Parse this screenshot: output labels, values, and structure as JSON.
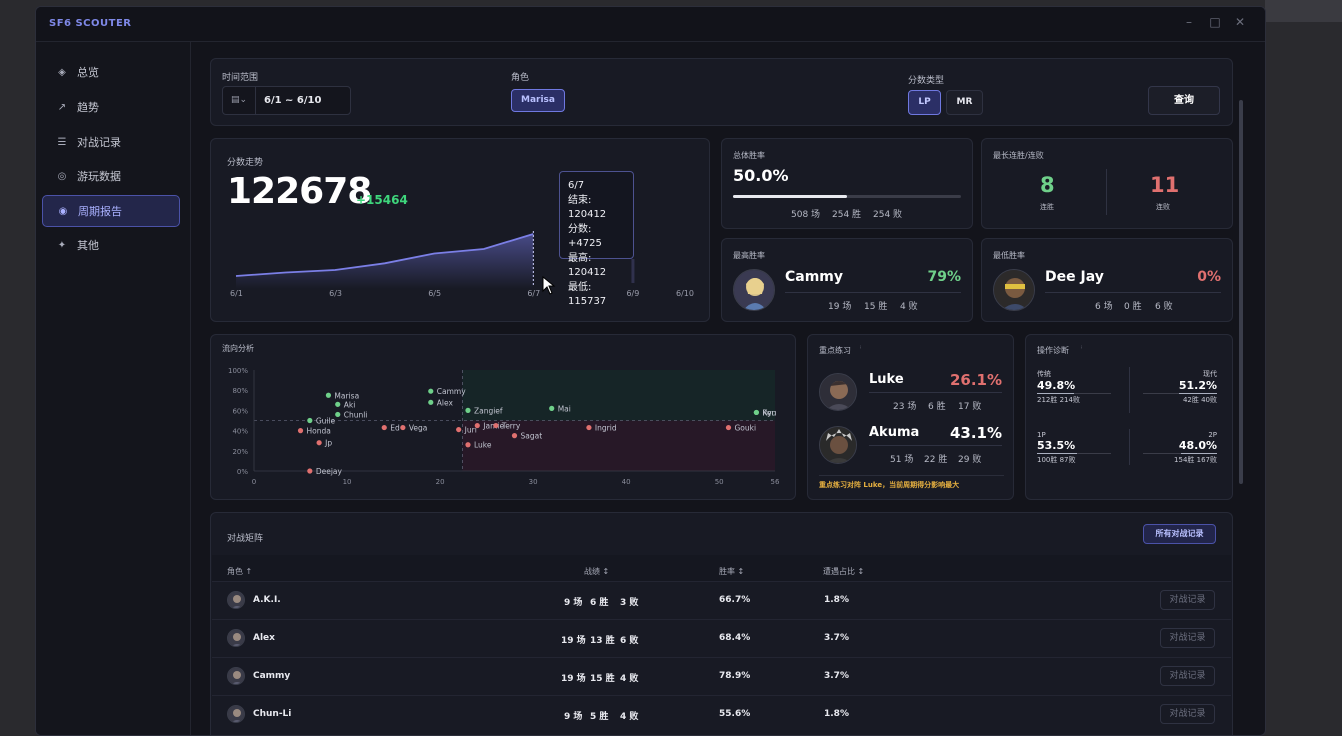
{
  "app": {
    "title": "SF6 SCOUTER"
  },
  "window_controls": {
    "minimize": "–",
    "maximize": "□",
    "close": "✕"
  },
  "sidebar": {
    "items": [
      {
        "label": "总览",
        "icon": "◈"
      },
      {
        "label": "趋势",
        "icon": "↗"
      },
      {
        "label": "对战记录",
        "icon": "☰"
      },
      {
        "label": "游玩数据",
        "icon": "◎"
      },
      {
        "label": "周期报告",
        "icon": "◉"
      },
      {
        "label": "其他",
        "icon": "✦"
      }
    ]
  },
  "filters": {
    "time_label": "时间范围",
    "time_value": "6/1 ~ 6/10",
    "char_label": "角色",
    "char_value": "Marisa",
    "score_label": "分数类型",
    "lp": "LP",
    "mr": "MR",
    "query": "查询"
  },
  "trend": {
    "title": "分数走势",
    "value": "122678",
    "delta": "+15464",
    "xticks": [
      "6/1",
      "6/3",
      "6/5",
      "6/7",
      "6/9",
      "6/10"
    ],
    "tooltip": [
      "6/7",
      "结束: 120412",
      "分数: +4725",
      "最高: 120412",
      "最低: 115737"
    ]
  },
  "overall": {
    "title": "总体胜率",
    "rate": "50.0%",
    "rate_value": 0.5,
    "games": "508 场",
    "wins": "254 胜",
    "losses": "254 败"
  },
  "streak": {
    "title": "最长连胜/连败",
    "win_value": "8",
    "win_label": "连胜",
    "lose_value": "11",
    "lose_label": "连败"
  },
  "best": {
    "title": "最高胜率",
    "name": "Cammy",
    "rate": "79%",
    "games": "19 场",
    "wins": "15 胜",
    "losses": "4 败"
  },
  "worst": {
    "title": "最低胜率",
    "name": "Dee Jay",
    "rate": "0%",
    "games": "6 场",
    "wins": "0 胜",
    "losses": "6 败"
  },
  "flow": {
    "title": "流向分析"
  },
  "focus": {
    "title": "重点练习",
    "items": [
      {
        "name": "Luke",
        "rate": "26.1%",
        "games": "23 场",
        "wins": "6 胜",
        "losses": "17 败"
      },
      {
        "name": "Akuma",
        "rate": "43.1%",
        "games": "51 场",
        "wins": "22 胜",
        "losses": "29 败"
      }
    ],
    "note": "重点练习对阵 Luke，当前周期得分影响最大"
  },
  "diag": {
    "title": "操作诊断",
    "cells": [
      {
        "label": "传统",
        "rate": "49.8%",
        "detail": "212胜 214败",
        "fill": 0.498,
        "align": "left"
      },
      {
        "label": "现代",
        "rate": "51.2%",
        "detail": "42胜 40败",
        "fill": 0.512,
        "align": "right"
      },
      {
        "label": "1P",
        "rate": "53.5%",
        "detail": "100胜 87败",
        "fill": 0.535,
        "align": "left"
      },
      {
        "label": "2P",
        "rate": "48.0%",
        "detail": "154胜 167败",
        "fill": 0.48,
        "align": "right"
      }
    ]
  },
  "matrix": {
    "title": "对战矩阵",
    "all_button": "所有对战记录",
    "headers": {
      "char": "角色 ↑",
      "record": "战绩 ↕",
      "rate": "胜率 ↕",
      "share": "遭遇占比 ↕"
    },
    "row_button": "对战记录",
    "rows": [
      {
        "name": "A.K.I.",
        "games": "9 场",
        "wins": "6 胜",
        "losses": "3 败",
        "rate": "66.7%",
        "share": "1.8%"
      },
      {
        "name": "Alex",
        "games": "19 场",
        "wins": "13 胜",
        "losses": "6 败",
        "rate": "68.4%",
        "share": "3.7%"
      },
      {
        "name": "Cammy",
        "games": "19 场",
        "wins": "15 胜",
        "losses": "4 败",
        "rate": "78.9%",
        "share": "3.7%"
      },
      {
        "name": "Chun-Li",
        "games": "9 场",
        "wins": "5 胜",
        "losses": "4 败",
        "rate": "55.6%",
        "share": "1.8%"
      }
    ]
  },
  "colors": {
    "accent": "#7f89e8",
    "green": "#6fd08a",
    "red": "#e0706f",
    "gold": "#e6b040"
  },
  "chart_data": [
    {
      "type": "area",
      "x": [
        "6/1",
        "6/2",
        "6/3",
        "6/4",
        "6/5",
        "6/6",
        "6/7"
      ],
      "values": [
        107214,
        108300,
        109100,
        111200,
        114300,
        115687,
        120412
      ],
      "xticks": [
        "6/1",
        "6/3",
        "6/5",
        "6/7",
        "6/9",
        "6/10"
      ]
    },
    {
      "type": "scatter",
      "title": "流向分析",
      "xlim": [
        0,
        56
      ],
      "ylim": [
        0,
        100
      ],
      "xticks": [
        0,
        10,
        20,
        30,
        40,
        50,
        56
      ],
      "yticks": [
        "0%",
        "20%",
        "40%",
        "60%",
        "80%",
        "100%"
      ],
      "points": [
        {
          "name": "Marisa",
          "x": 8,
          "y": 75,
          "group": "green"
        },
        {
          "name": "Aki",
          "x": 9,
          "y": 66,
          "group": "green"
        },
        {
          "name": "Chunli",
          "x": 9,
          "y": 56,
          "group": "green"
        },
        {
          "name": "Guile",
          "x": 6,
          "y": 50,
          "group": "green"
        },
        {
          "name": "Honda",
          "x": 5,
          "y": 40,
          "group": "red"
        },
        {
          "name": "Jp",
          "x": 7,
          "y": 28,
          "group": "red"
        },
        {
          "name": "Deejay",
          "x": 6,
          "y": 0,
          "group": "red"
        },
        {
          "name": "Cammy",
          "x": 19,
          "y": 79,
          "group": "green"
        },
        {
          "name": "Alex",
          "x": 19,
          "y": 68,
          "group": "green"
        },
        {
          "name": "Ed",
          "x": 14,
          "y": 43,
          "group": "red"
        },
        {
          "name": "Vega",
          "x": 16,
          "y": 43,
          "group": "red"
        },
        {
          "name": "Juri",
          "x": 22,
          "y": 41,
          "group": "red"
        },
        {
          "name": "Zangief",
          "x": 23,
          "y": 60,
          "group": "green"
        },
        {
          "name": "Jamie",
          "x": 24,
          "y": 45,
          "group": "red"
        },
        {
          "name": "Terry",
          "x": 26,
          "y": 45,
          "group": "red"
        },
        {
          "name": "Sagat",
          "x": 28,
          "y": 35,
          "group": "red"
        },
        {
          "name": "Luke",
          "x": 23,
          "y": 26,
          "group": "red"
        },
        {
          "name": "Mai",
          "x": 32,
          "y": 62,
          "group": "green"
        },
        {
          "name": "Ingrid",
          "x": 36,
          "y": 43,
          "group": "red"
        },
        {
          "name": "Gouki",
          "x": 51,
          "y": 43,
          "group": "red"
        },
        {
          "name": "Ryu",
          "x": 54,
          "y": 58,
          "group": "green"
        },
        {
          "name": "Ken",
          "x": 54,
          "y": 58,
          "group": "green"
        }
      ]
    }
  ]
}
